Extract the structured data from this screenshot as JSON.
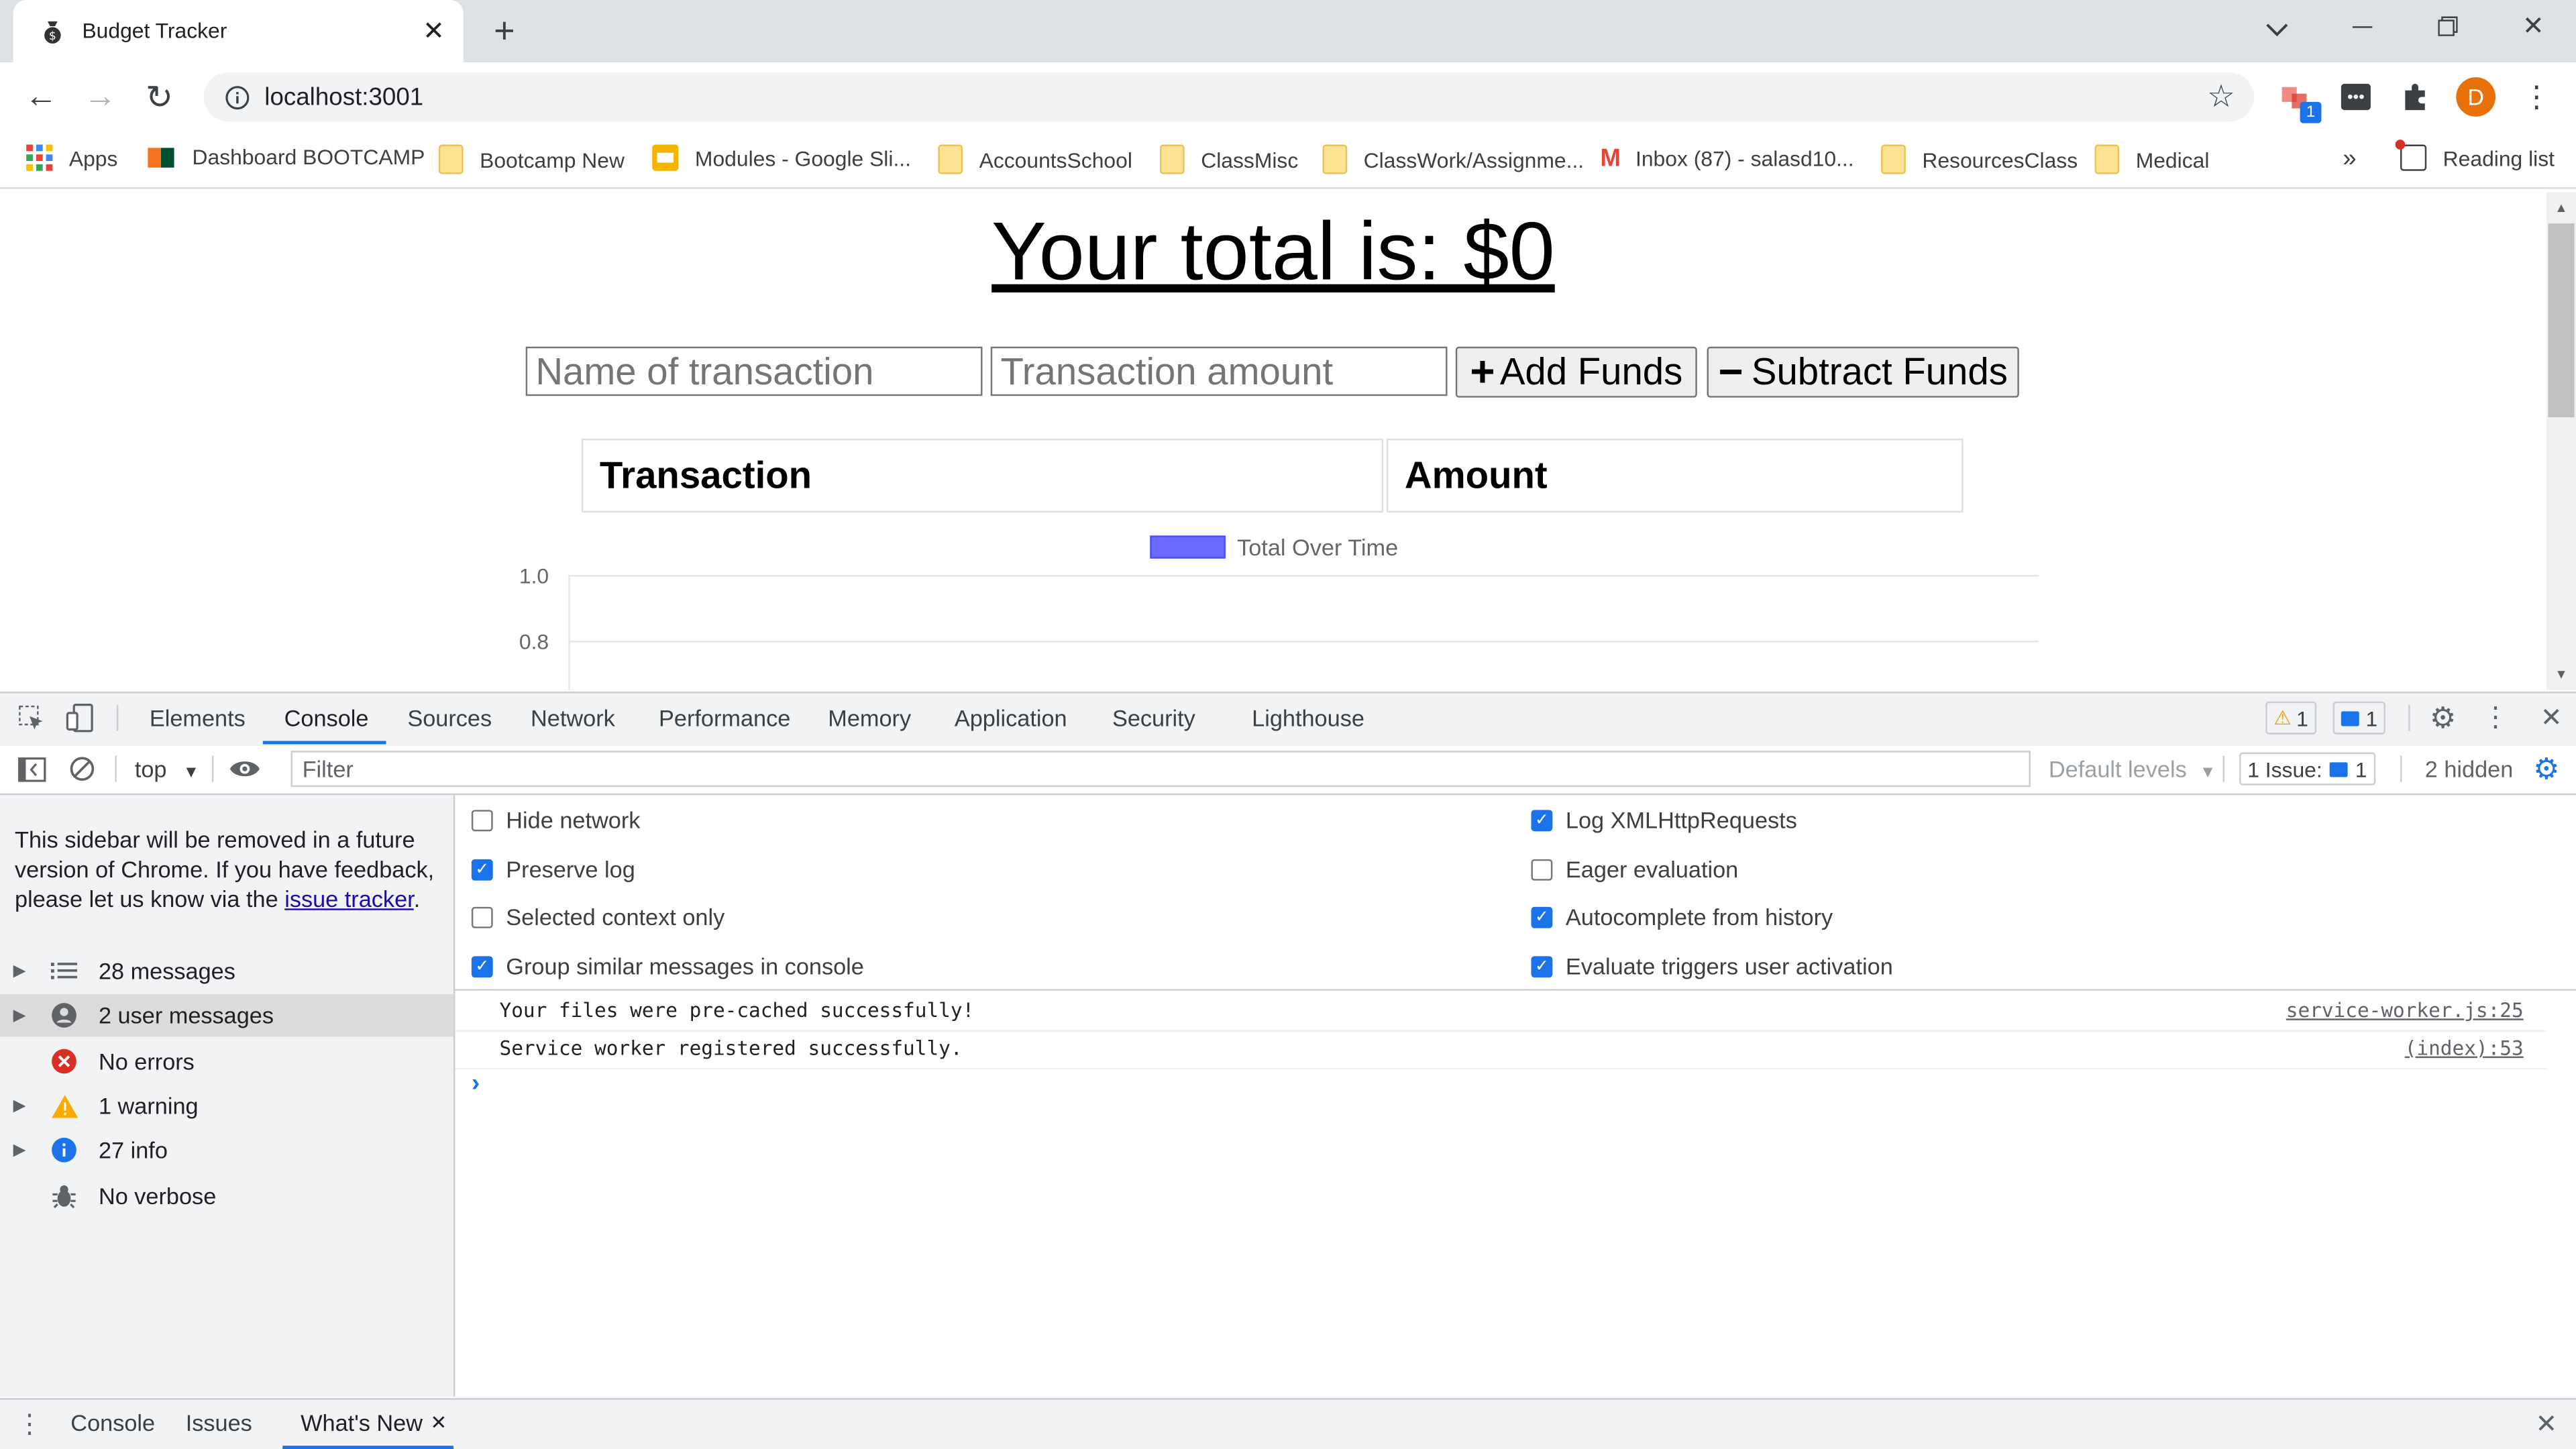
{
  "browser": {
    "tab_title": "Budget Tracker",
    "url": "localhost:3001",
    "profile_initial": "D",
    "extension_badge": "1",
    "bookmarks": [
      {
        "label": "Apps",
        "icon": "apps-grid-icon"
      },
      {
        "label": "Dashboard BOOTCAMP",
        "icon": "um-logo-icon"
      },
      {
        "label": "Bootcamp New",
        "icon": "folder-icon"
      },
      {
        "label": "Modules - Google Sli...",
        "icon": "slides-icon"
      },
      {
        "label": "AccountsSchool",
        "icon": "folder-icon"
      },
      {
        "label": "ClassMisc",
        "icon": "folder-icon"
      },
      {
        "label": "ClassWork/Assignme...",
        "icon": "folder-icon"
      },
      {
        "label": "Inbox (87) - salasd10...",
        "icon": "gmail-icon"
      },
      {
        "label": "ResourcesClass",
        "icon": "folder-icon"
      },
      {
        "label": "Medical",
        "icon": "folder-icon"
      }
    ],
    "more_bookmarks": "»",
    "reading_list": "Reading list"
  },
  "page": {
    "total_heading": "Your total is: $0",
    "name_placeholder": "Name of transaction",
    "amount_placeholder": "Transaction amount",
    "add_button": "Add Funds",
    "add_symbol": "+",
    "subtract_button": "Subtract Funds",
    "subtract_symbol": "−",
    "table_headers": [
      "Transaction",
      "Amount"
    ],
    "chart": {
      "legend": "Total Over Time",
      "legend_color": "#6b6bff",
      "y_ticks": [
        "1.0",
        "0.8"
      ]
    }
  },
  "chart_data": {
    "type": "line",
    "series": [
      {
        "name": "Total Over Time",
        "values": []
      }
    ],
    "x": [],
    "ylim": [
      0,
      1.0
    ],
    "y_ticks": [
      1.0,
      0.8
    ],
    "legend": "top"
  },
  "devtools": {
    "tabs": [
      "Elements",
      "Console",
      "Sources",
      "Network",
      "Performance",
      "Memory",
      "Application",
      "Security",
      "Lighthouse"
    ],
    "active_tab": "Console",
    "warning_count": "1",
    "message_count": "1",
    "context": "top",
    "filter_placeholder": "Filter",
    "default_levels": "Default levels",
    "issues_label": "1 Issue:",
    "issues_count": "1",
    "hidden_label": "2 hidden",
    "sidebar_note_text": "This sidebar will be removed in a future version of Chrome. If you have feedback, please let us know via the ",
    "sidebar_note_link": "issue tracker",
    "sidebar_note_end": ".",
    "sidebar_items": [
      {
        "label": "28 messages",
        "expandable": true,
        "icon": "list-icon"
      },
      {
        "label": "2 user messages",
        "expandable": true,
        "icon": "user-icon"
      },
      {
        "label": "No errors",
        "expandable": false,
        "icon": "error-icon"
      },
      {
        "label": "1 warning",
        "expandable": true,
        "icon": "warning-icon"
      },
      {
        "label": "27 info",
        "expandable": true,
        "icon": "info-icon"
      },
      {
        "label": "No verbose",
        "expandable": false,
        "icon": "bug-icon"
      }
    ],
    "settings": {
      "left": [
        {
          "label": "Hide network",
          "checked": false
        },
        {
          "label": "Preserve log",
          "checked": true
        },
        {
          "label": "Selected context only",
          "checked": false
        },
        {
          "label": "Group similar messages in console",
          "checked": true
        }
      ],
      "right": [
        {
          "label": "Log XMLHttpRequests",
          "checked": true
        },
        {
          "label": "Eager evaluation",
          "checked": false
        },
        {
          "label": "Autocomplete from history",
          "checked": true
        },
        {
          "label": "Evaluate triggers user activation",
          "checked": true
        }
      ]
    },
    "console_messages": [
      {
        "text": "Your files were pre-cached successfully!",
        "source": "service-worker.js:25"
      },
      {
        "text": "Service worker registered successfully.",
        "source": "(index):53"
      }
    ],
    "prompt": "›",
    "drawer_tabs": [
      "Console",
      "Issues",
      "What's New"
    ],
    "drawer_active": "What's New"
  }
}
